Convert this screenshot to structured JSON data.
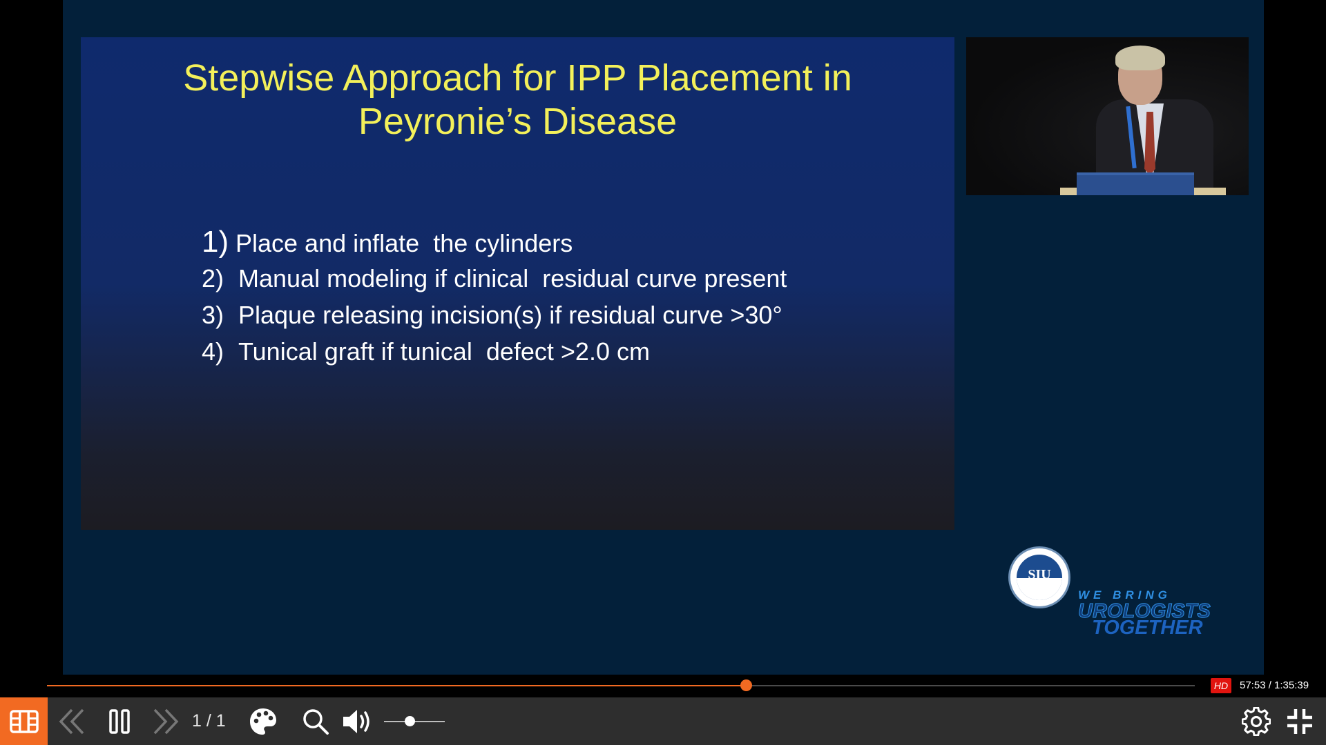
{
  "slide": {
    "title_line1": "Stepwise Approach for IPP Placement in",
    "title_line2": "Peyronie’s Disease",
    "items": [
      {
        "num": "1)",
        "text": "Place and inflate  the cylinders"
      },
      {
        "num": "2)",
        "text": "Manual modeling if clinical  residual curve present"
      },
      {
        "num": "3)",
        "text": "Plaque releasing incision(s) if residual curve >30°"
      },
      {
        "num": "4)",
        "text": "Tunical graft if tunical  defect >2.0 cm"
      }
    ]
  },
  "branding": {
    "logo_text": "SIU",
    "slogan_line1": "WE BRING",
    "slogan_line2": "UROLOGISTS",
    "slogan_line3": "TOGETHER"
  },
  "player": {
    "progress_fraction": 0.6088,
    "hd_badge": "HD",
    "time": "57:53 / 1:35:39",
    "page_indicator": "1 / 1",
    "volume_fraction": 0.42,
    "accent_color": "#f26a22"
  }
}
